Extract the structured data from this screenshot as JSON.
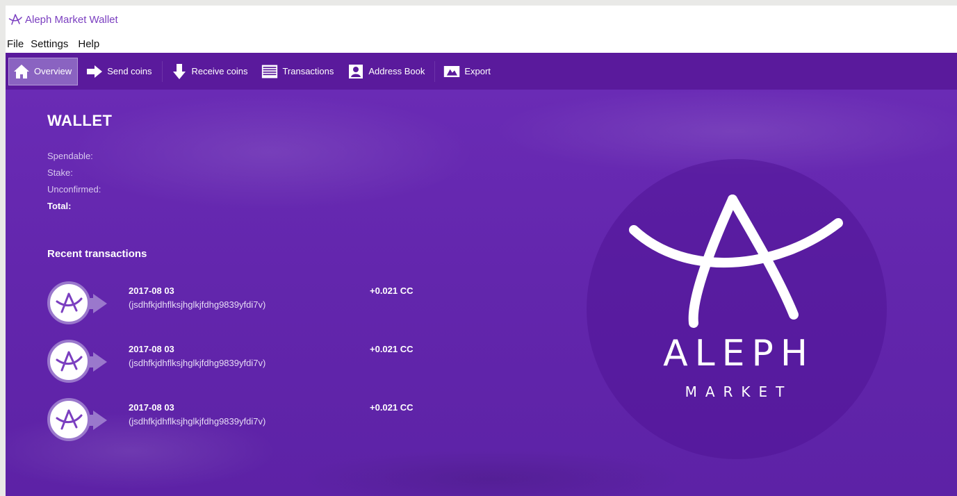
{
  "window": {
    "title": "Aleph Market Wallet"
  },
  "menu": {
    "items": [
      "File",
      "Settings",
      "Help"
    ]
  },
  "toolbar": {
    "items": [
      {
        "label": "Overview",
        "icon": "home-icon",
        "active": true
      },
      {
        "label": "Send coins",
        "icon": "arrow-right-icon",
        "active": false
      },
      {
        "label": "Receive coins",
        "icon": "arrow-down-icon",
        "active": false
      },
      {
        "label": "Transactions",
        "icon": "list-icon",
        "active": false
      },
      {
        "label": "Address Book",
        "icon": "contact-icon",
        "active": false
      },
      {
        "label": "Export",
        "icon": "export-icon",
        "active": false
      }
    ]
  },
  "wallet": {
    "title": "WALLET",
    "spendable_label": "Spendable:",
    "stake_label": "Stake:",
    "unconfirmed_label": "Unconfirmed:",
    "total_label": "Total:"
  },
  "recent": {
    "title": "Recent transactions",
    "transactions": [
      {
        "date": "2017-08 03",
        "id": "(jsdhfkjdhflksjhglkjfdhg9839yfdi7v)",
        "amount": "+0.021 CC"
      },
      {
        "date": "2017-08 03",
        "id": "(jsdhfkjdhflksjhglkjfdhg9839yfdi7v)",
        "amount": "+0.021 CC"
      },
      {
        "date": "2017-08 03",
        "id": "(jsdhfkjdhflksjhglkjfdhg9839yfdi7v)",
        "amount": "+0.021 CC"
      }
    ]
  },
  "brand": {
    "name": "ALEPH",
    "sub": "MARKET"
  },
  "colors": {
    "primary": "#5a1a9c",
    "background": "#6326ad",
    "accent": "#9a78cc",
    "title_text": "#7b3fc0"
  }
}
